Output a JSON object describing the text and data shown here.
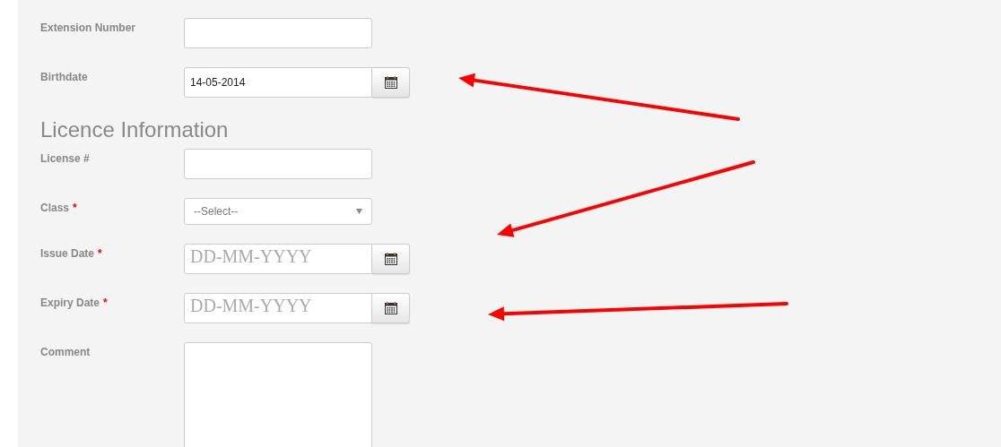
{
  "fields_top": [
    {
      "kind": "text",
      "label": "Extension Number",
      "required": false
    },
    {
      "kind": "date",
      "label": "Birthdate",
      "required": false,
      "value": "14-05-2014"
    }
  ],
  "section_title": "Licence Information",
  "fields": [
    {
      "kind": "text",
      "label": "License #",
      "required": false
    },
    {
      "kind": "select",
      "label": "Class",
      "required": true,
      "value": "--Select--"
    },
    {
      "kind": "date",
      "label": "Issue Date",
      "required": true,
      "placeholder": "DD-MM-YYYY"
    },
    {
      "kind": "date",
      "label": "Expiry Date",
      "required": true,
      "placeholder": "DD-MM-YYYY"
    },
    {
      "kind": "textarea",
      "label": "Comment",
      "required": false
    }
  ],
  "required_mark": "*"
}
